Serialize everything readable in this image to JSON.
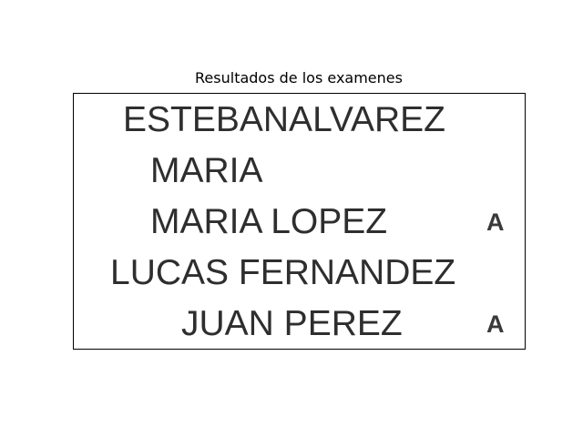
{
  "title": "Resultados de los examenes",
  "rows": [
    {
      "name": "ESTEBANALVAREZ",
      "grade": ""
    },
    {
      "name": "MARIA",
      "grade": ""
    },
    {
      "name": "MARIA LOPEZ",
      "grade": "A"
    },
    {
      "name": "LUCAS FERNANDEZ",
      "grade": ""
    },
    {
      "name": "JUAN PEREZ",
      "grade": "A"
    }
  ]
}
